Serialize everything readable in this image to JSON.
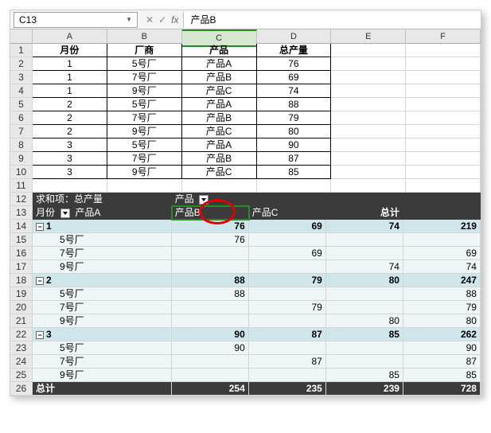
{
  "app": {
    "cell_ref": "C13",
    "formula_value": "产品B"
  },
  "columns": [
    "A",
    "B",
    "C",
    "D",
    "E",
    "F"
  ],
  "table": {
    "headers": [
      "月份",
      "厂商",
      "产品",
      "总产量"
    ],
    "rows": [
      [
        "1",
        "5号厂",
        "产品A",
        "76"
      ],
      [
        "1",
        "7号厂",
        "产品B",
        "69"
      ],
      [
        "1",
        "9号厂",
        "产品C",
        "74"
      ],
      [
        "2",
        "5号厂",
        "产品A",
        "88"
      ],
      [
        "2",
        "7号厂",
        "产品B",
        "79"
      ],
      [
        "2",
        "9号厂",
        "产品C",
        "80"
      ],
      [
        "3",
        "5号厂",
        "产品A",
        "90"
      ],
      [
        "3",
        "7号厂",
        "产品B",
        "87"
      ],
      [
        "3",
        "9号厂",
        "产品C",
        "85"
      ]
    ]
  },
  "pivot": {
    "title": "求和项：总产量",
    "col_field": "产品",
    "row_field": "月份",
    "col_labels": [
      "产品A",
      "产品B",
      "产品C",
      "总计"
    ],
    "groups": [
      {
        "key": "1",
        "subtotal": [
          "76",
          "69",
          "74",
          "219"
        ],
        "children": [
          {
            "label": "5号厂",
            "vals": [
              "76",
              "",
              "",
              ""
            ]
          },
          {
            "label": "7号厂",
            "vals": [
              "",
              "69",
              "",
              "69"
            ]
          },
          {
            "label": "9号厂",
            "vals": [
              "",
              "",
              "74",
              "74"
            ]
          }
        ]
      },
      {
        "key": "2",
        "subtotal": [
          "88",
          "79",
          "80",
          "247"
        ],
        "children": [
          {
            "label": "5号厂",
            "vals": [
              "88",
              "",
              "",
              "88"
            ]
          },
          {
            "label": "7号厂",
            "vals": [
              "",
              "79",
              "",
              "79"
            ]
          },
          {
            "label": "9号厂",
            "vals": [
              "",
              "",
              "80",
              "80"
            ]
          }
        ]
      },
      {
        "key": "3",
        "subtotal": [
          "90",
          "87",
          "85",
          "262"
        ],
        "children": [
          {
            "label": "5号厂",
            "vals": [
              "90",
              "",
              "",
              "90"
            ]
          },
          {
            "label": "7号厂",
            "vals": [
              "",
              "87",
              "",
              "87"
            ]
          },
          {
            "label": "9号厂",
            "vals": [
              "",
              "",
              "85",
              "85"
            ]
          }
        ]
      }
    ],
    "grand_label": "总计",
    "grand": [
      "254",
      "235",
      "239",
      "728"
    ]
  },
  "row_numbers": {
    "data_start": 1,
    "pivot_start": 12
  }
}
